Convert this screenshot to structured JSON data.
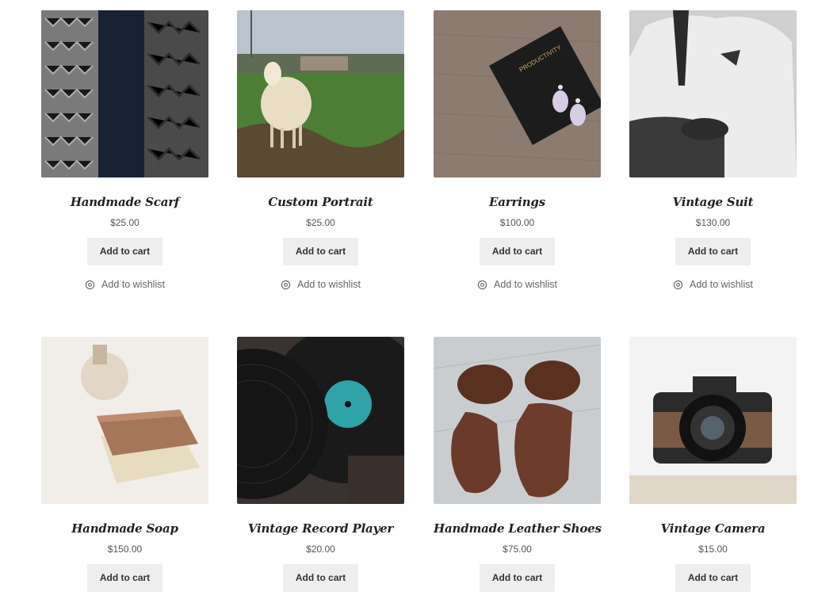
{
  "products": [
    {
      "name": "Handmade Scarf",
      "price": "$25.00",
      "image_icon": "knit-scarf-photo",
      "cart_label": "Add to cart",
      "wishlist_label": "Add to wishlist"
    },
    {
      "name": "Custom Portrait",
      "price": "$25.00",
      "image_icon": "sheep-photo",
      "cart_label": "Add to cart",
      "wishlist_label": "Add to wishlist"
    },
    {
      "name": "Earrings",
      "price": "$100.00",
      "image_icon": "earrings-notebook-photo",
      "cart_label": "Add to cart",
      "wishlist_label": "Add to wishlist"
    },
    {
      "name": "Vintage Suit",
      "price": "$130.00",
      "image_icon": "suit-photo",
      "cart_label": "Add to cart",
      "wishlist_label": "Add to wishlist"
    },
    {
      "name": "Handmade Soap",
      "price": "$150.00",
      "image_icon": "soap-photo",
      "cart_label": "Add to cart"
    },
    {
      "name": "Vintage Record Player",
      "price": "$20.00",
      "image_icon": "record-player-photo",
      "cart_label": "Add to cart"
    },
    {
      "name": "Handmade Leather Shoes",
      "price": "$75.00",
      "image_icon": "leather-shoes-photo",
      "cart_label": "Add to cart"
    },
    {
      "name": "Vintage Camera",
      "price": "$15.00",
      "image_icon": "camera-photo",
      "cart_label": "Add to cart"
    }
  ]
}
